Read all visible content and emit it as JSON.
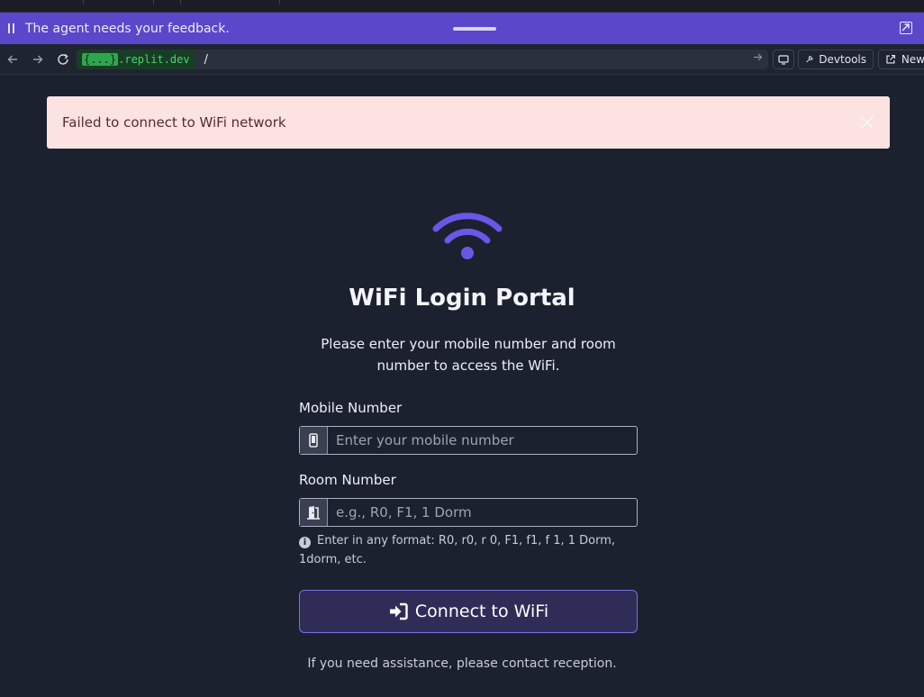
{
  "agent_bar": {
    "message": "The agent needs your feedback."
  },
  "url_bar": {
    "domain_brace": "{...}",
    "domain_rest": ".replit.dev",
    "path": "/",
    "devtools_label": "Devtools",
    "new_tab_label": "New"
  },
  "alert": {
    "message": "Failed to connect to WiFi network"
  },
  "portal": {
    "title": "WiFi Login Portal",
    "subtitle": "Please enter your mobile number and room number to access the WiFi.",
    "mobile_label": "Mobile Number",
    "mobile_placeholder": "Enter your mobile number",
    "room_label": "Room Number",
    "room_placeholder": "e.g., R0, F1, 1 Dorm",
    "room_hint": "Enter in any format: R0, r0, r 0, F1, f1, f 1, 1 Dorm, 1dorm, etc.",
    "connect_label": "Connect to WiFi",
    "footer": "If you need assistance, please contact reception."
  },
  "colors": {
    "accent": "#6b57e6",
    "alert_bg": "#fde2e2",
    "agent_bar": "#5a47c9"
  },
  "icons": [
    "pause-icon",
    "expand-icon",
    "back-icon",
    "forward-icon",
    "reload-icon",
    "forward-arrow-icon",
    "screen-icon",
    "wrench-icon",
    "external-link-icon",
    "close-icon",
    "wifi-icon",
    "phone-icon",
    "door-icon",
    "info-icon",
    "sign-in-icon"
  ]
}
